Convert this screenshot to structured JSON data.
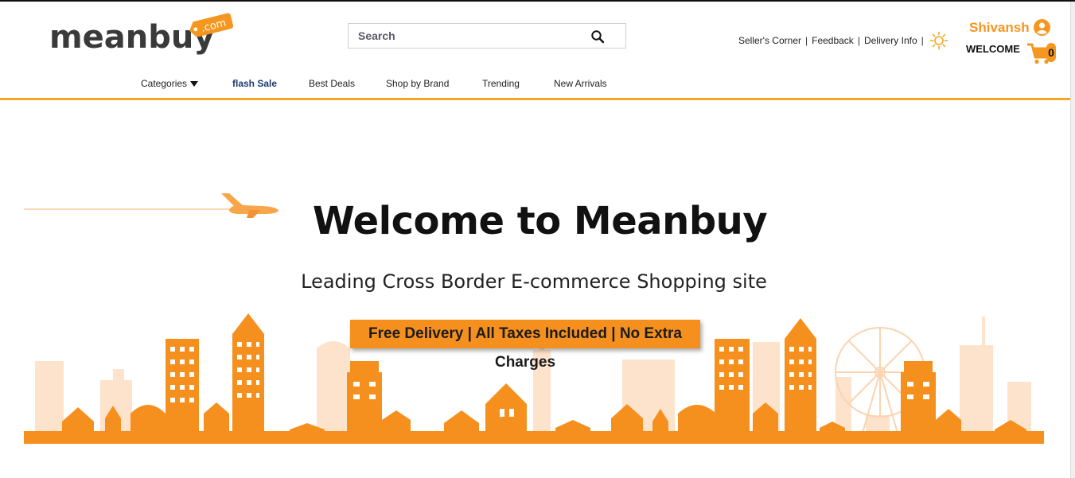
{
  "brand": {
    "logo_text": "meanbuy",
    "logo_tag": ".com",
    "color_accent": "#f5961f",
    "color_dark": "#3a3a3a"
  },
  "search": {
    "placeholder": "Search",
    "icon": "search-icon"
  },
  "top_links": [
    {
      "label": "Seller's Corner"
    },
    {
      "label": "Feedback"
    },
    {
      "label": "Delivery Info"
    }
  ],
  "theme_toggle": {
    "icon": "sun-icon"
  },
  "user": {
    "name": "Shivansh",
    "icon": "user-circle-icon",
    "greeting": "WELCOME"
  },
  "cart": {
    "icon": "cart-icon",
    "count": "0"
  },
  "nav": {
    "categories": "Categories",
    "flash_sale": "flash Sale",
    "best_deals": "Best Deals",
    "shop_by_brand": "Shop by Brand",
    "trending": "Trending",
    "new_arrivals": "New Arrivals"
  },
  "hero": {
    "title": "Welcome to Meanbuy",
    "subtitle": "Leading Cross Border E-commerce Shopping site",
    "banner": "Free Delivery | All Taxes Included | No Extra Charges",
    "color_building_light": "#fde3cc",
    "color_building": "#f5901e"
  }
}
